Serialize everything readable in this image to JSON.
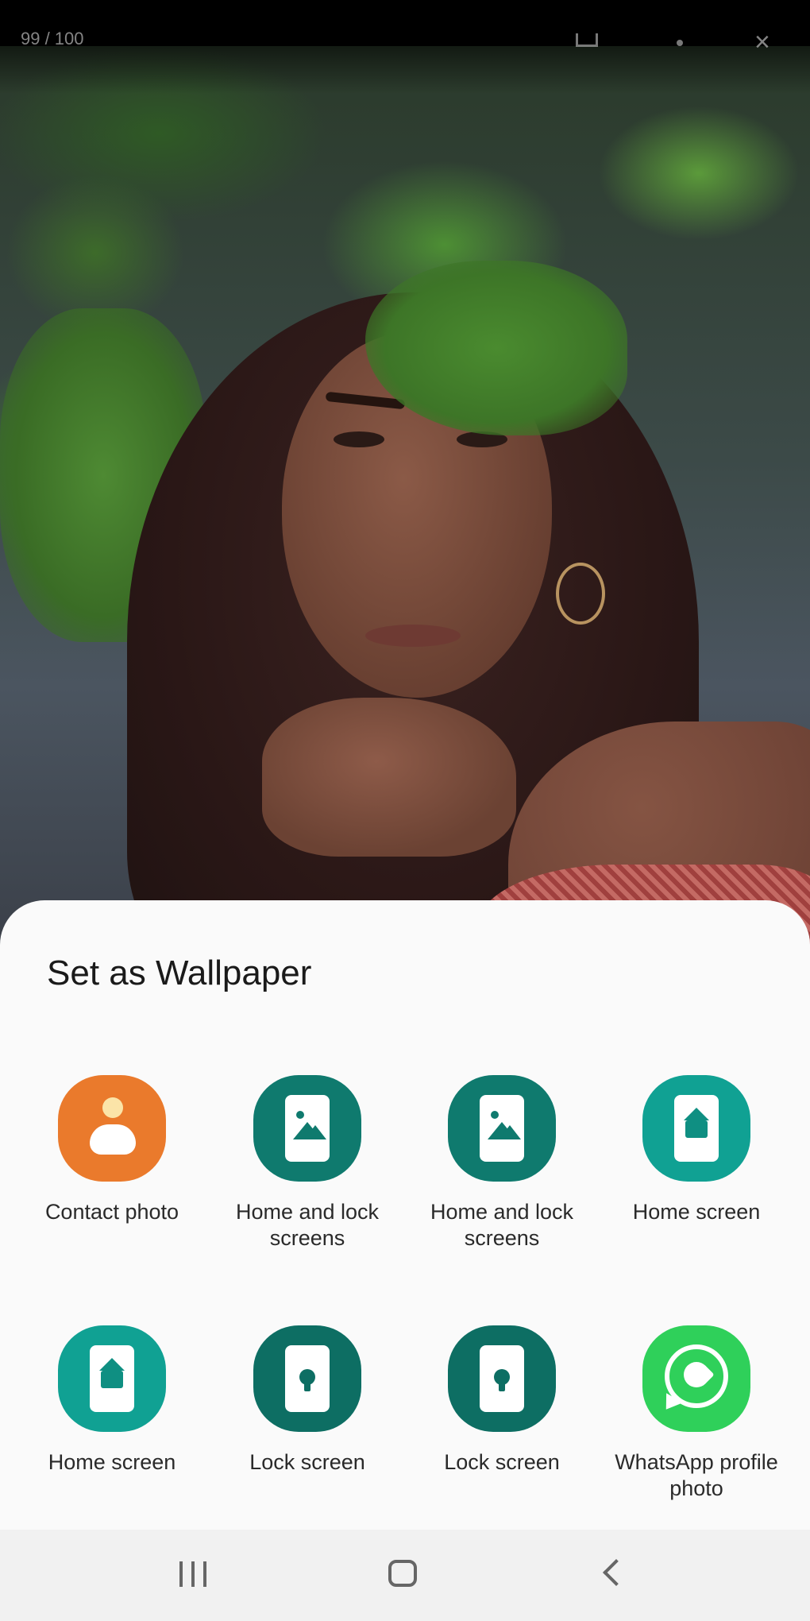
{
  "viewer": {
    "counter_text": "99 / 100",
    "close_glyph": "×"
  },
  "sheet": {
    "title": "Set as Wallpaper",
    "items": [
      {
        "label": "Contact photo",
        "icon": "contact-photo-icon",
        "color": "#ea7a2c"
      },
      {
        "label": "Home and lock screens",
        "icon": "gallery-image-icon",
        "color": "#0f7a6e"
      },
      {
        "label": "Home and lock screens",
        "icon": "gallery-image-icon",
        "color": "#0f7a6e"
      },
      {
        "label": "Home screen",
        "icon": "home-screen-icon",
        "color": "#10a193"
      },
      {
        "label": "Home screen",
        "icon": "home-screen-icon",
        "color": "#10a193"
      },
      {
        "label": "Lock screen",
        "icon": "lock-screen-icon",
        "color": "#0d6e63"
      },
      {
        "label": "Lock screen",
        "icon": "lock-screen-icon",
        "color": "#0d6e63"
      },
      {
        "label": "WhatsApp profile photo",
        "icon": "whatsapp-icon",
        "color": "#2fd05a"
      }
    ]
  },
  "navigation": {
    "recent_apps": "recent-apps-icon",
    "home": "home-nav-icon",
    "back": "back-icon"
  }
}
